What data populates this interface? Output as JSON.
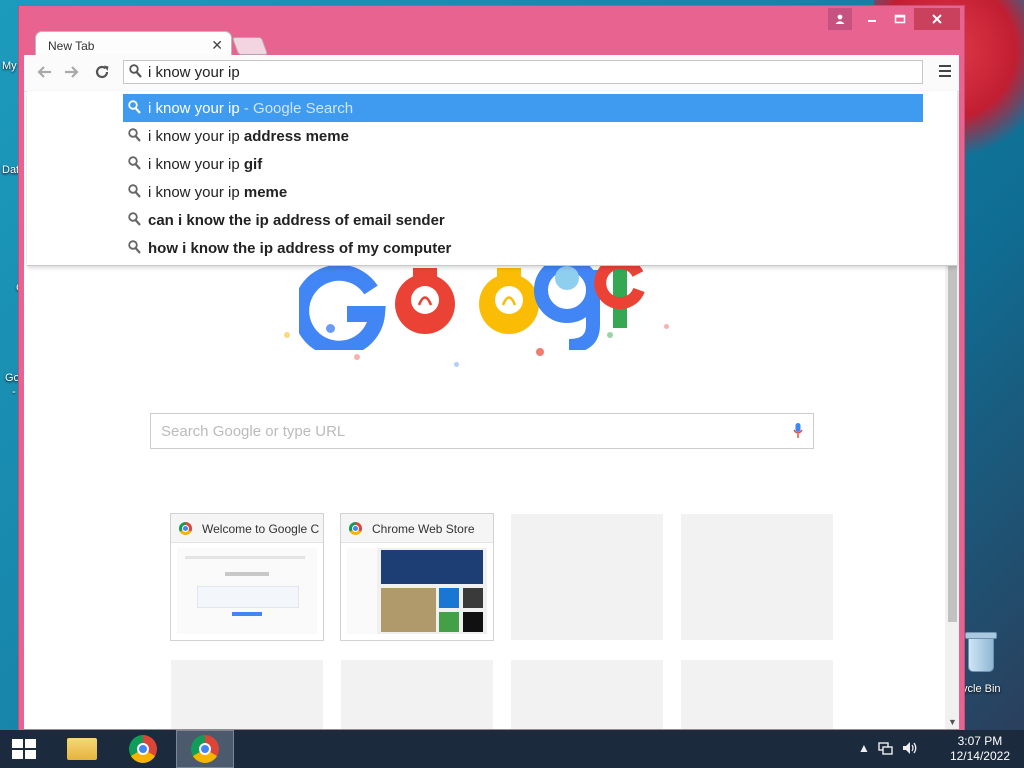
{
  "desktop": {
    "icons": [
      {
        "label": "My"
      },
      {
        "label": "Dat"
      },
      {
        "label": "C"
      },
      {
        "label": "Go"
      },
      {
        "label": "-"
      }
    ],
    "recycle_bin_label": "ycle Bin"
  },
  "window": {
    "tab_title": "New Tab",
    "tab_close": "✕",
    "omnibox_value": "i know your ip",
    "search_placeholder": "Search Google or type URL"
  },
  "suggestions": [
    {
      "normal": "i know your ip",
      "bold": "",
      "hint": " - Google Search",
      "selected": true
    },
    {
      "normal": "i know your ip ",
      "bold": "address meme",
      "hint": ""
    },
    {
      "normal": "i know your ip ",
      "bold": "gif",
      "hint": ""
    },
    {
      "normal": "i know your ip ",
      "bold": "meme",
      "hint": ""
    },
    {
      "normal": "",
      "bold": "can i know the ip address of email sender",
      "hint": ""
    },
    {
      "normal": "",
      "bold": "how i know the ip address of my computer",
      "hint": ""
    }
  ],
  "tiles": [
    {
      "title": "Welcome to Google C"
    },
    {
      "title": "Chrome Web Store"
    }
  ],
  "taskbar": {
    "time": "3:07 PM",
    "date": "12/14/2022"
  },
  "colors": {
    "window_frame": "#e8638f",
    "selected_suggestion": "#3f9bf0"
  }
}
